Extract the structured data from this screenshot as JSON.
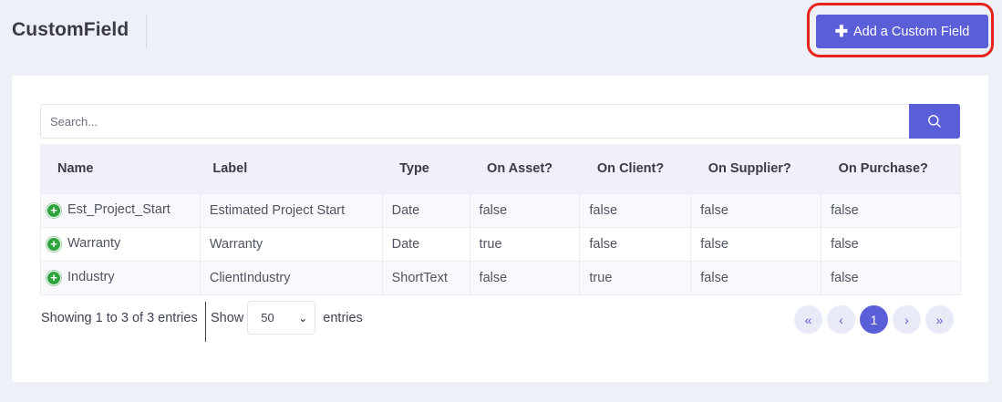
{
  "header": {
    "title": "CustomField",
    "add_button_label": "Add a Custom Field"
  },
  "search": {
    "placeholder": "Search..."
  },
  "table": {
    "columns": [
      "Name",
      "Label",
      "Type",
      "On Asset?",
      "On Client?",
      "On Supplier?",
      "On Purchase?"
    ],
    "rows": [
      {
        "name": "Est_Project_Start",
        "label": "Estimated Project Start",
        "type": "Date",
        "on_asset": "false",
        "on_client": "false",
        "on_supplier": "false",
        "on_purchase": "false"
      },
      {
        "name": "Warranty",
        "label": "Warranty",
        "type": "Date",
        "on_asset": "true",
        "on_client": "false",
        "on_supplier": "false",
        "on_purchase": "false"
      },
      {
        "name": "Industry",
        "label": "ClientIndustry",
        "type": "ShortText",
        "on_asset": "false",
        "on_client": "true",
        "on_supplier": "false",
        "on_purchase": "false"
      }
    ]
  },
  "footer": {
    "info": "Showing 1 to 3 of 3 entries",
    "show_label": "Show",
    "page_size": "50",
    "entries_label": "entries"
  },
  "pagination": {
    "first": "«",
    "prev": "‹",
    "current": "1",
    "next": "›",
    "last": "»"
  },
  "colors": {
    "accent": "#5a5fd8",
    "highlight": "#e8231c",
    "expand": "#2ea33c"
  }
}
